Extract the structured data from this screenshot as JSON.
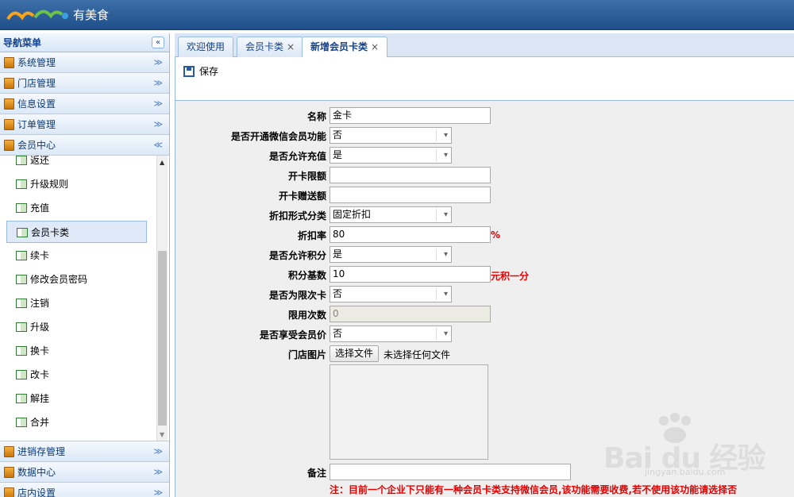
{
  "header": {
    "brand": "有美食"
  },
  "sidebar": {
    "title": "导航菜单",
    "collapse_icon": "«",
    "groups_top": [
      {
        "label": "系统管理",
        "chev": "≫"
      },
      {
        "label": "门店管理",
        "chev": "≫"
      },
      {
        "label": "信息设置",
        "chev": "≫"
      },
      {
        "label": "订单管理",
        "chev": "≫"
      }
    ],
    "open_group": {
      "label": "会员中心",
      "chev": "≪"
    },
    "sub_items": [
      {
        "label": "返还"
      },
      {
        "label": "升级规则"
      },
      {
        "label": "充值"
      },
      {
        "label": "会员卡类",
        "active": true
      },
      {
        "label": "续卡"
      },
      {
        "label": "修改会员密码"
      },
      {
        "label": "注销"
      },
      {
        "label": "升级"
      },
      {
        "label": "换卡"
      },
      {
        "label": "改卡"
      },
      {
        "label": "解挂"
      },
      {
        "label": "合并"
      }
    ],
    "groups_bottom": [
      {
        "label": "进销存管理",
        "chev": "≫"
      },
      {
        "label": "数据中心",
        "chev": "≫"
      },
      {
        "label": "店内设置",
        "chev": "≫"
      }
    ]
  },
  "tabs": [
    {
      "label": "欢迎使用",
      "closable": false
    },
    {
      "label": "会员卡类",
      "closable": true,
      "close": "×"
    },
    {
      "label": "新增会员卡类",
      "closable": true,
      "close": "×",
      "active": true
    }
  ],
  "toolbar": {
    "save_label": "保存"
  },
  "form": {
    "name": {
      "label": "名称",
      "value": "金卡"
    },
    "wechat": {
      "label": "是否开通微信会员功能",
      "value": "否"
    },
    "allow_recharge": {
      "label": "是否允许充值",
      "value": "是"
    },
    "open_limit": {
      "label": "开卡限额",
      "value": ""
    },
    "open_bonus": {
      "label": "开卡赠送额",
      "value": ""
    },
    "discount_type": {
      "label": "折扣形式分类",
      "value": "固定折扣"
    },
    "discount_rate": {
      "label": "折扣率",
      "value": "80",
      "suffix": "%"
    },
    "allow_points": {
      "label": "是否允许积分",
      "value": "是"
    },
    "points_base": {
      "label": "积分基数",
      "value": "10",
      "suffix": "元积一分"
    },
    "limited_times": {
      "label": "是否为限次卡",
      "value": "否"
    },
    "times_count": {
      "label": "限用次数",
      "value": "0"
    },
    "member_price": {
      "label": "是否享受会员价",
      "value": "否"
    },
    "store_image": {
      "label": "门店图片",
      "button": "选择文件",
      "status": "未选择任何文件"
    },
    "remark": {
      "label": "备注",
      "value": ""
    },
    "note": "注：目前一个企业下只能有一种会员卡类支持微信会员,该功能需要收费,若不使用该功能请选择否"
  },
  "dropdown_arrow": "▾",
  "watermark": {
    "text": "Bai du 经验",
    "url": "jingyan.baidu.com"
  },
  "colors": {
    "header": "#2a5c98",
    "accent": "#15428b",
    "warning": "#e60000"
  }
}
